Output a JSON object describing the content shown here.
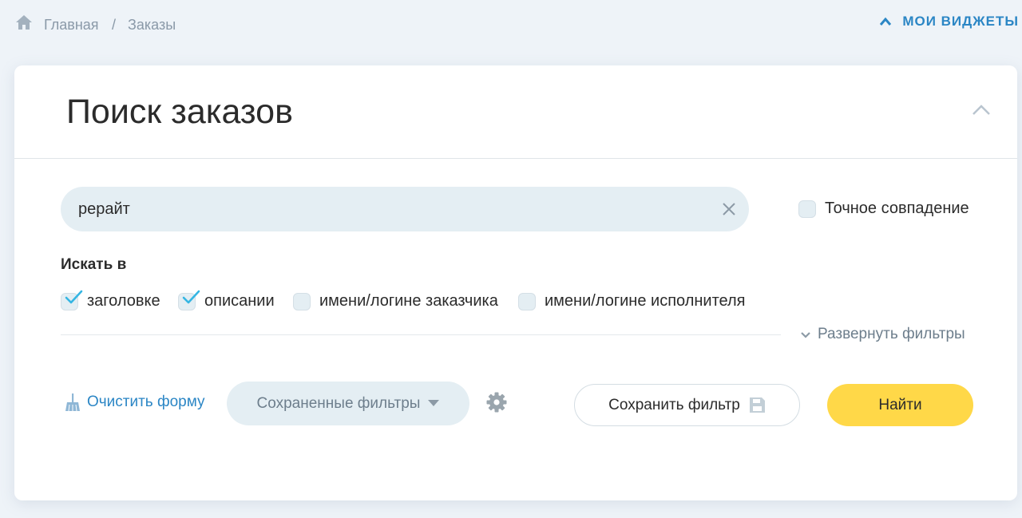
{
  "breadcrumb": {
    "home": "Главная",
    "separator": "/",
    "current": "Заказы"
  },
  "header": {
    "widgets_label": "МОИ ВИДЖЕТЫ"
  },
  "card": {
    "title": "Поиск заказов"
  },
  "search": {
    "query": "рерайт",
    "exact_match_label": "Точное совпадение",
    "exact_match_checked": false
  },
  "search_in": {
    "label": "Искать в",
    "options": [
      {
        "label": "заголовке",
        "checked": true
      },
      {
        "label": "описании",
        "checked": true
      },
      {
        "label": "имени/логине заказчика",
        "checked": false
      },
      {
        "label": "имени/логине исполнителя",
        "checked": false
      }
    ]
  },
  "expand_filters_label": "Развернуть фильтры",
  "actions": {
    "clear_form": "Очистить форму",
    "saved_filters": "Сохраненные фильтры",
    "save_filter": "Сохранить фильтр",
    "find": "Найти"
  },
  "colors": {
    "accent": "#2b86c5",
    "primary_button": "#ffd848",
    "check": "#35b6e3",
    "field_bg": "#e4eef3"
  }
}
